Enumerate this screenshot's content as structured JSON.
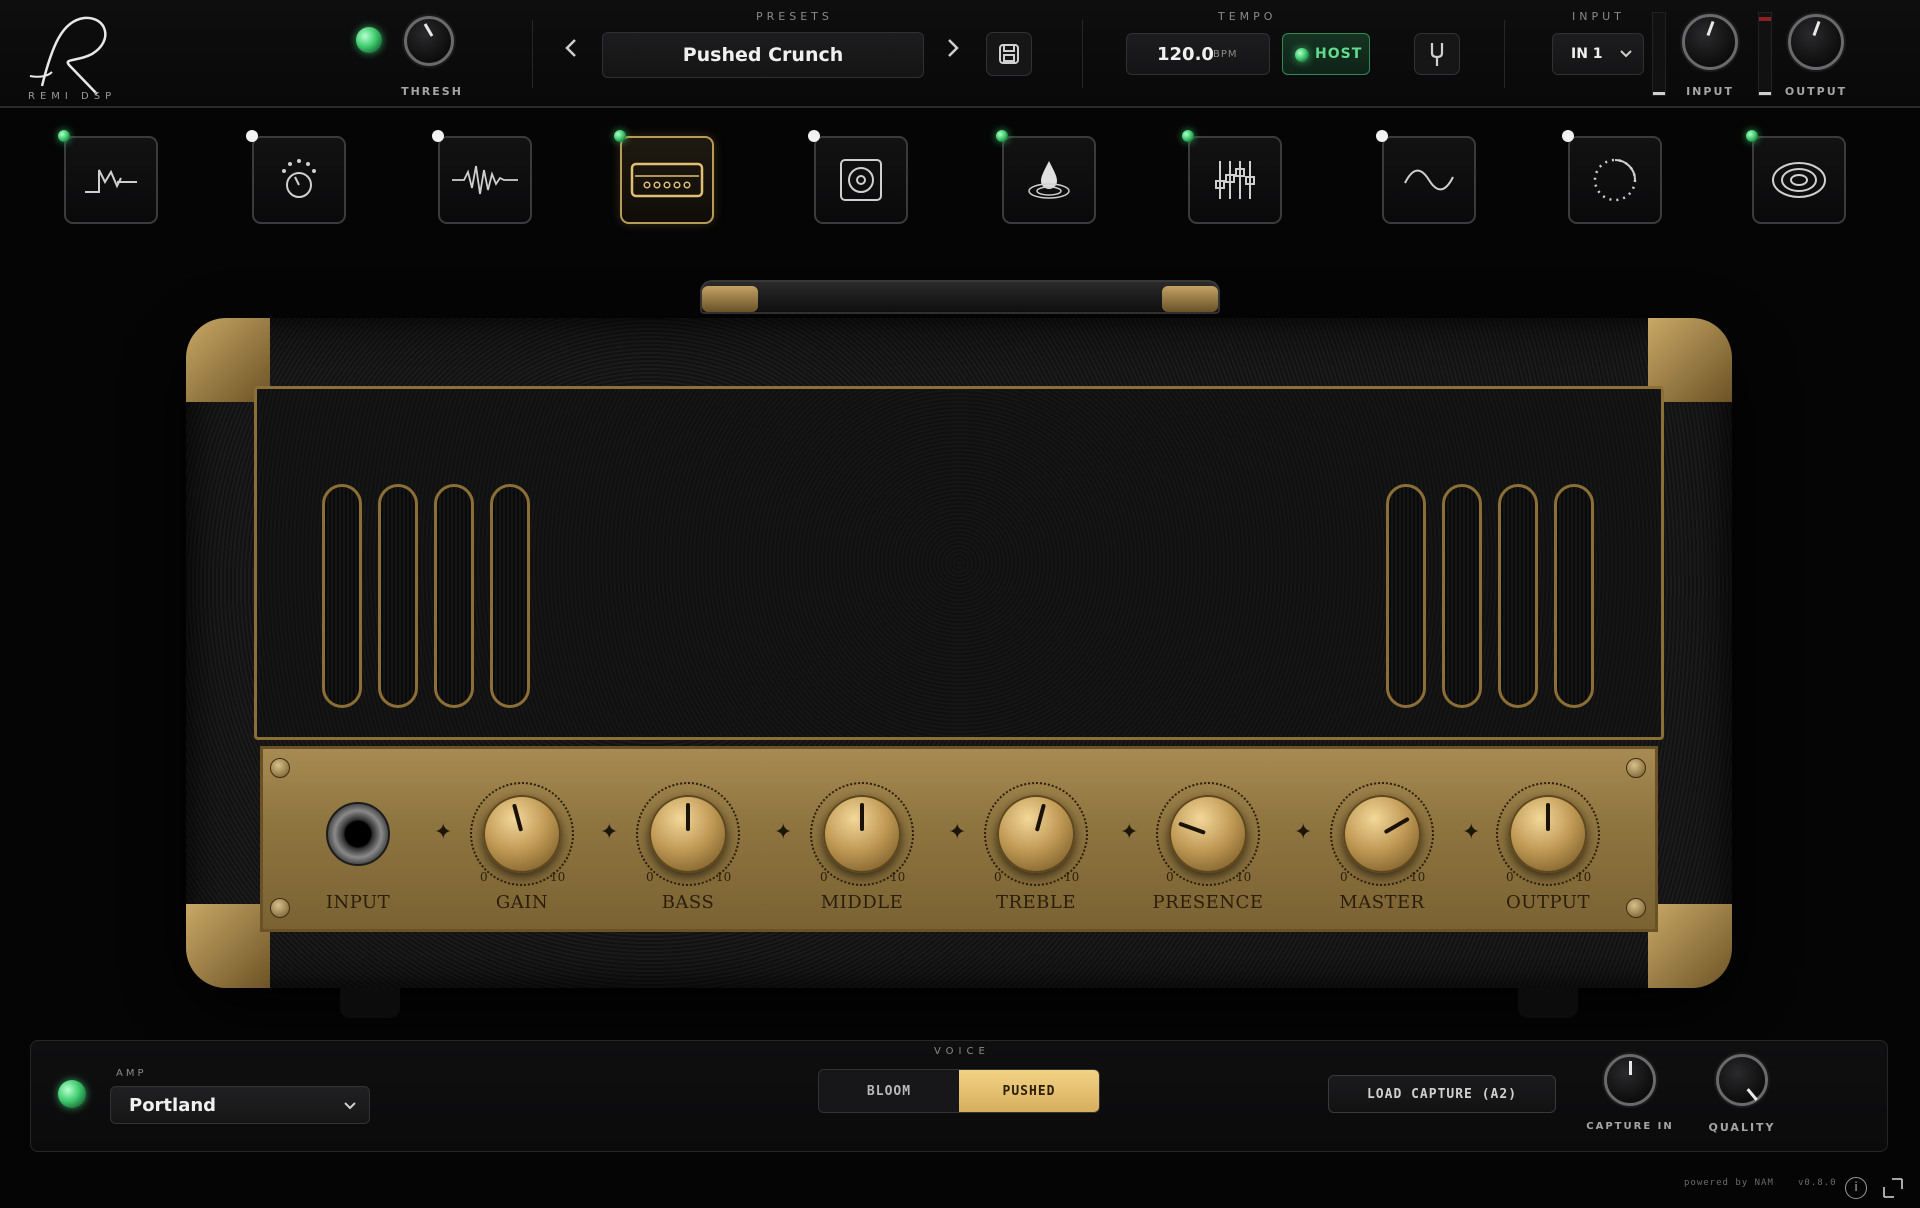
{
  "brand": {
    "logo_letter": "R",
    "name": "REMI DSP"
  },
  "gate": {
    "label": "THRESH",
    "enabled": true
  },
  "presets": {
    "section_label": "PRESETS",
    "current": "Pushed Crunch",
    "prev_icon": "chevron-left-icon",
    "next_icon": "chevron-right-icon",
    "save_icon": "save-icon"
  },
  "tempo": {
    "section_label": "TEMPO",
    "value": "120.0",
    "unit": "BPM",
    "host_label": "HOST",
    "host_enabled": true
  },
  "tuner": {
    "icon": "tuning-fork-icon"
  },
  "input": {
    "section_label": "INPUT",
    "channel": "IN 1",
    "input_knob_label": "INPUT",
    "output_knob_label": "OUTPUT"
  },
  "modules": [
    {
      "name": "noise-gate",
      "icon": "gate-curve-icon",
      "enabled": true
    },
    {
      "name": "compressor",
      "icon": "dial-gauge-icon",
      "enabled": false
    },
    {
      "name": "overdrive",
      "icon": "waveform-icon",
      "enabled": false
    },
    {
      "name": "amp",
      "icon": "amp-head-icon",
      "enabled": true,
      "selected": true
    },
    {
      "name": "cabinet",
      "icon": "speaker-cab-icon",
      "enabled": false
    },
    {
      "name": "saturation",
      "icon": "droplet-icon",
      "enabled": true
    },
    {
      "name": "eq",
      "icon": "sliders-icon",
      "enabled": true
    },
    {
      "name": "modulation",
      "icon": "sine-wave-icon",
      "enabled": false
    },
    {
      "name": "delay",
      "icon": "dotted-circle-icon",
      "enabled": false
    },
    {
      "name": "reverb",
      "icon": "ripple-icon",
      "enabled": true
    }
  ],
  "amp_panel": {
    "input_label": "INPUT",
    "scale_min": "0",
    "scale_max": "10",
    "knobs": [
      {
        "label": "GAIN",
        "angle": -15
      },
      {
        "label": "BASS",
        "angle": 0
      },
      {
        "label": "MIDDLE",
        "angle": 0
      },
      {
        "label": "TREBLE",
        "angle": 15
      },
      {
        "label": "PRESENCE",
        "angle": -70
      },
      {
        "label": "MASTER",
        "angle": 60
      },
      {
        "label": "OUTPUT",
        "angle": 0
      }
    ]
  },
  "bottom": {
    "amp_label": "AMP",
    "amp_model": "Portland",
    "amp_enabled": true,
    "voice_label": "VOICE",
    "voice_options": [
      "BLOOM",
      "PUSHED"
    ],
    "voice_selected": "PUSHED",
    "load_capture": "LOAD CAPTURE (A2)",
    "capture_in_label": "CAPTURE IN",
    "quality_label": "QUALITY"
  },
  "footer": {
    "powered": "powered by NAM",
    "version": "v0.8.0"
  },
  "colors": {
    "accent_gold": "#d6af5d",
    "led_green": "#3fcb6f",
    "background": "#050505"
  }
}
